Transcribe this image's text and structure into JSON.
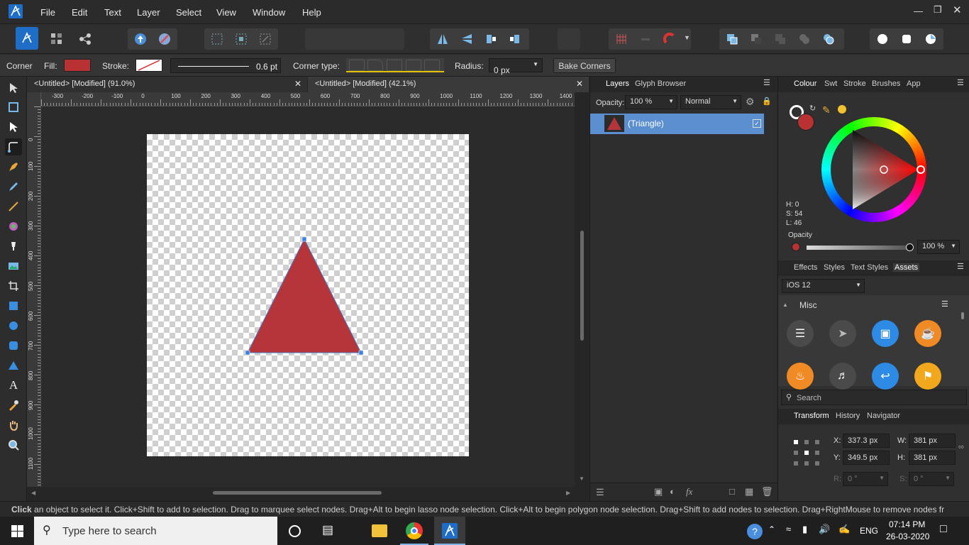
{
  "menu": {
    "items": [
      "File",
      "Edit",
      "Text",
      "Layer",
      "Select",
      "View",
      "Window",
      "Help"
    ]
  },
  "context": {
    "tool_label": "Corner",
    "fill_label": "Fill:",
    "fill_color": "#b83234",
    "stroke_label": "Stroke:",
    "stroke_width": "0.6 pt",
    "corner_type_label": "Corner type:",
    "radius_label": "Radius:",
    "radius_value": "0 px",
    "bake_corners": "Bake Corners"
  },
  "tabs": [
    {
      "label": "<Untitled> [Modified] (91.0%)"
    },
    {
      "label": "<Untitled> [Modified] (42.1%)"
    }
  ],
  "ruler": {
    "unit": "px",
    "h_ticks": [
      "-300",
      "-200",
      "-100",
      "0",
      "100",
      "200",
      "300",
      "400",
      "500",
      "600",
      "700",
      "800",
      "900",
      "1000",
      "1100",
      "1200",
      "1300",
      "1400"
    ],
    "v_ticks": [
      "0",
      "100",
      "200",
      "300",
      "400",
      "500",
      "600",
      "700",
      "800",
      "900",
      "1000",
      "1100"
    ]
  },
  "shape": {
    "fill": "#b5353a",
    "stroke": "#4a78c6"
  },
  "layers": {
    "tabs": [
      "Layers",
      "Glyph Browser"
    ],
    "opacity_label": "Opacity:",
    "opacity_value": "100 %",
    "blend_mode": "Normal",
    "layer_name": "(Triangle)"
  },
  "colour": {
    "tabs": [
      "Colour",
      "Swt",
      "Stroke",
      "Brushes",
      "App"
    ],
    "h": "H: 0",
    "s": "S: 54",
    "l": "L: 46",
    "opacity_label": "Opacity",
    "opacity_value": "100 %"
  },
  "assets": {
    "tabs": [
      "Effects",
      "Styles",
      "Text Styles",
      "Assets"
    ],
    "set": "iOS 12",
    "category": "Misc",
    "search_placeholder": "Search"
  },
  "transform": {
    "tabs": [
      "Transform",
      "History",
      "Navigator"
    ],
    "x_label": "X:",
    "x": "337.3 px",
    "y_label": "Y:",
    "y": "349.5 px",
    "w_label": "W:",
    "w": "381 px",
    "h_label": "H:",
    "h": "381 px",
    "r_label": "R:",
    "r": "0 °",
    "s_label": "S:",
    "s": "0 °"
  },
  "status_text": "an object to select it. Click+Shift to add to selection. Drag to marquee select nodes. Drag+Alt to begin lasso node selection. Click+Alt to begin polygon node selection. Drag+Shift to add nodes to selection. Drag+RightMouse to remove nodes fr",
  "status_lead": "Click",
  "taskbar": {
    "search_placeholder": "Type here to search",
    "lang": "ENG",
    "time": "07:14 PM",
    "date": "26-03-2020"
  }
}
